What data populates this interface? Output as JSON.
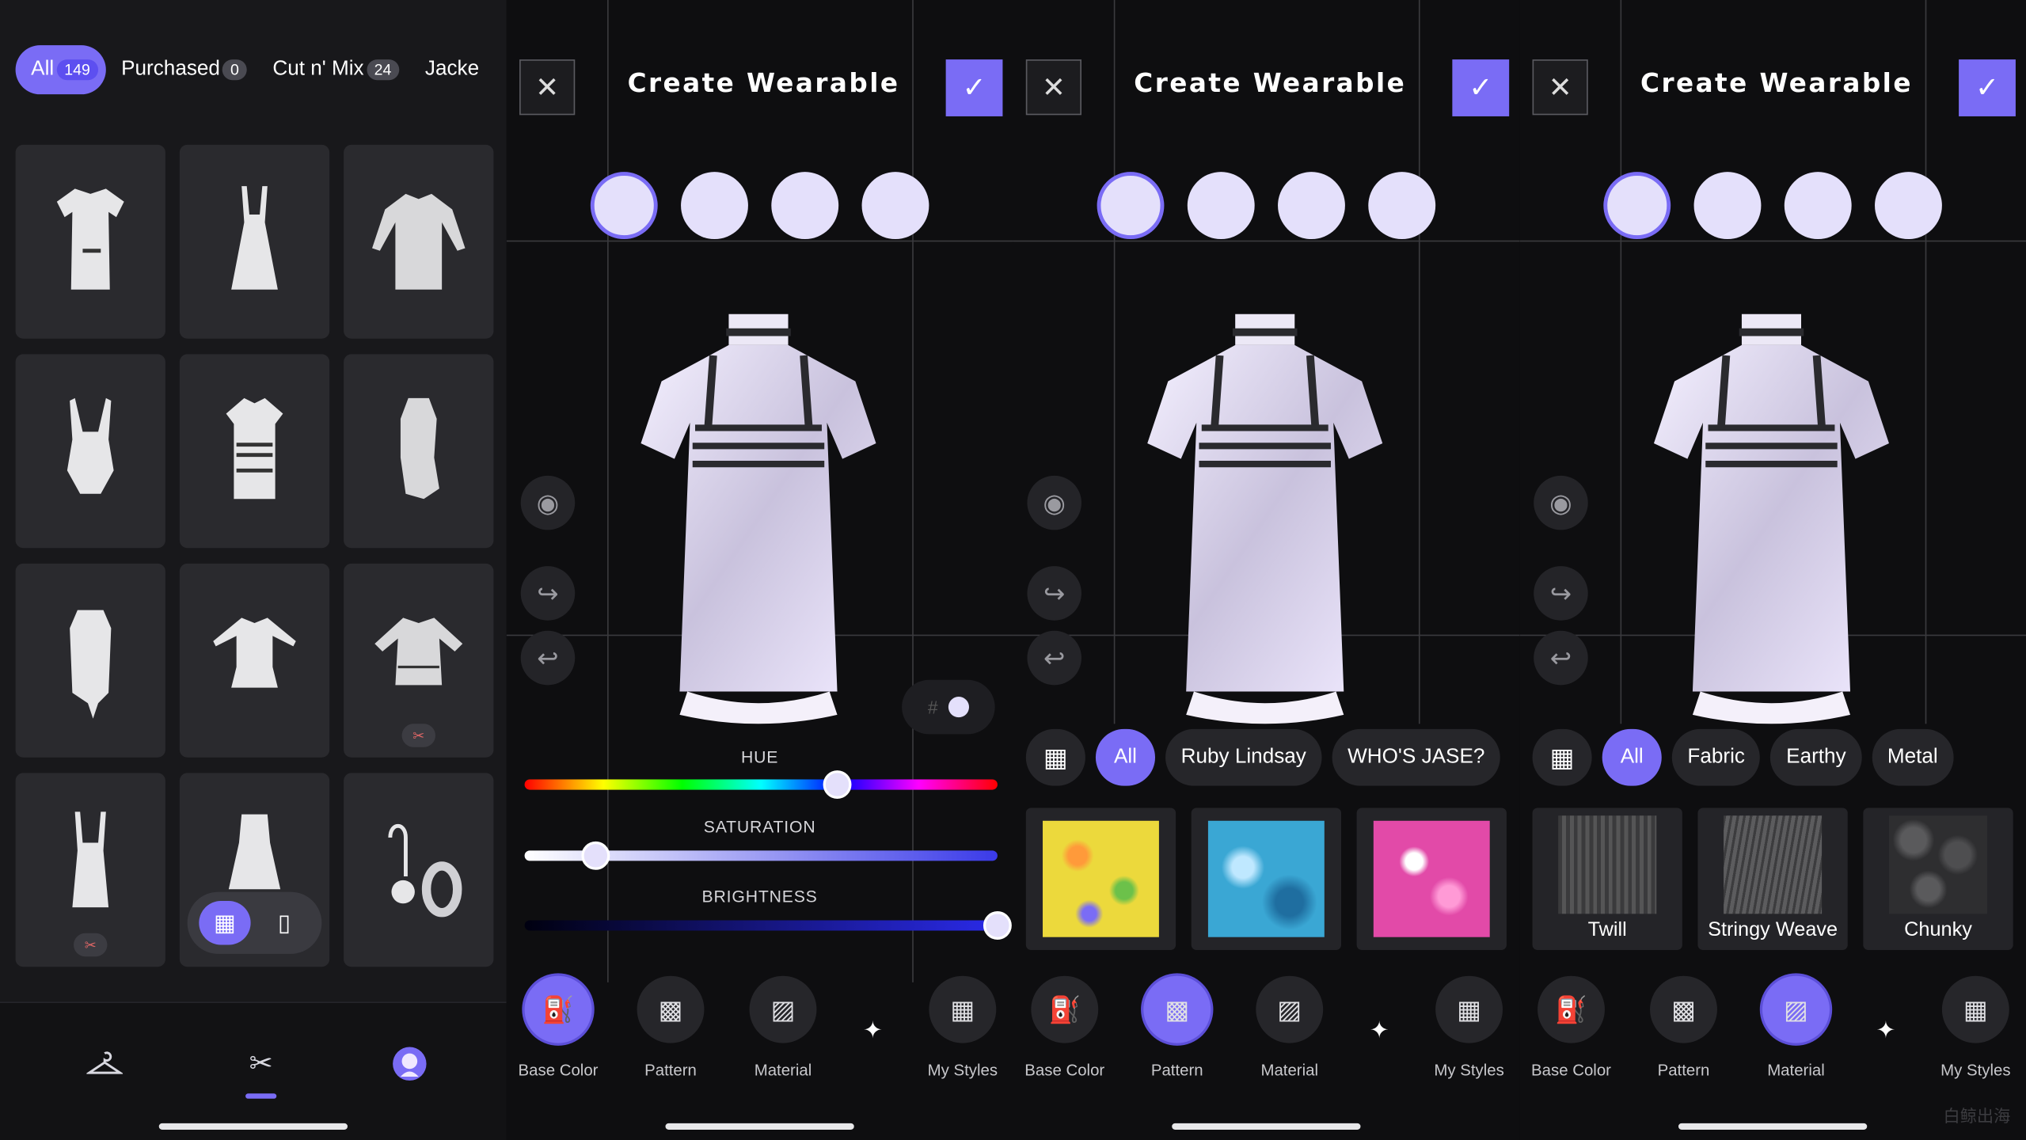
{
  "closet": {
    "tabs": [
      {
        "label": "All",
        "count": "149"
      },
      {
        "label": "Purchased",
        "count": "0"
      },
      {
        "label": "Cut n' Mix",
        "count": "24"
      },
      {
        "label": "Jacke",
        "count": ""
      }
    ],
    "items": [
      {
        "icon": "tshirt-dress-icon"
      },
      {
        "icon": "slip-dress-icon"
      },
      {
        "icon": "long-sleeve-dress-icon"
      },
      {
        "icon": "swimsuit-icon"
      },
      {
        "icon": "striped-dress-icon"
      },
      {
        "icon": "wrap-top-icon"
      },
      {
        "icon": "draped-top-icon"
      },
      {
        "icon": "cropped-jacket-icon"
      },
      {
        "icon": "ruffle-jacket-icon",
        "badge": "scissors-icon"
      },
      {
        "icon": "halter-top-icon",
        "badge": "scissors-icon"
      },
      {
        "icon": "mini-dress-icon"
      },
      {
        "icon": "earrings-icon"
      }
    ],
    "view_toggle": {
      "grid_icon": "grid-view-icon",
      "single_icon": "single-view-icon",
      "active": "grid"
    },
    "nav": [
      {
        "icon": "hanger-icon"
      },
      {
        "icon": "scissors-icon",
        "active": true
      },
      {
        "icon": "avatar-icon"
      }
    ]
  },
  "editor": {
    "title": "Create Wearable",
    "close_icon": "close-icon",
    "confirm_icon": "check-icon",
    "accent": "#7a6cf5",
    "swatch_color": "#e4e0fb",
    "side_icons": [
      "eye-icon",
      "redo-icon",
      "undo-icon"
    ],
    "hex_prefix": "#",
    "sliders": {
      "hue": {
        "label": "HUE",
        "value": 0.66
      },
      "saturation": {
        "label": "SATURATION",
        "value": 0.15
      },
      "brightness": {
        "label": "BRIGHTNESS",
        "value": 1.0
      }
    },
    "pattern_chips": [
      "All",
      "Ruby Lindsay",
      "WHO'S JASE?"
    ],
    "pattern_thumbs": [
      {
        "name": "yellow-floral-pattern",
        "color": "#e8d73a"
      },
      {
        "name": "blue-water-pattern",
        "color": "#3aa7d4"
      },
      {
        "name": "pink-floral-pattern",
        "color": "#e24aa8"
      }
    ],
    "material_chips": [
      "All",
      "Fabric",
      "Earthy",
      "Metal"
    ],
    "material_thumbs": [
      "Twill",
      "Stringy Weave",
      "Chunky"
    ],
    "tools": [
      {
        "label": "Base Color",
        "icon": "paint-bucket-icon"
      },
      {
        "label": "Pattern",
        "icon": "pattern-icon"
      },
      {
        "label": "Material",
        "icon": "material-icon"
      },
      {
        "label": "My Styles",
        "icon": "my-styles-icon"
      }
    ],
    "sparkle_icon": "sparkle-icon"
  },
  "watermark": "白鲸出海"
}
